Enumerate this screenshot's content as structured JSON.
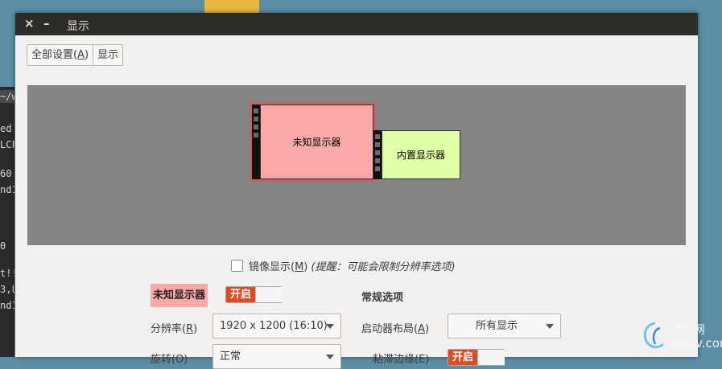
{
  "window": {
    "title": "显示",
    "close_symbol": "×",
    "minimize_symbol": "–"
  },
  "toolbar": {
    "all_settings": {
      "text": "全部设置(",
      "mnemonic": "A",
      "suffix": ")"
    },
    "display": "显示"
  },
  "monitors": [
    {
      "name": "未知显示器",
      "color": "#fba8a8",
      "selected": true
    },
    {
      "name": "内置显示器",
      "color": "#e1ffa8",
      "selected": false
    }
  ],
  "mirror": {
    "label_text": "镜像显示(",
    "label_mnemonic": "M",
    "label_suffix": ")",
    "hint": "(提醒：可能会限制分辨率选项)",
    "checked": false
  },
  "selected_monitor": {
    "name": "未知显示器",
    "toggle_label": "开启"
  },
  "general_options": {
    "title": "常规选项",
    "launcher_label": {
      "text": "启动器布局(",
      "mnemonic": "A",
      "suffix": ")"
    },
    "launcher_value": "所有显示",
    "sticky_label": "粘滞边缘(E)",
    "sticky_toggle": "开启"
  },
  "resolution": {
    "label": {
      "text": "分辨率(",
      "mnemonic": "R",
      "suffix": ")"
    },
    "value": "1920 x 1200 (16:10)"
  },
  "rotation": {
    "label": "旋转(O)",
    "value": "正常"
  },
  "terminal_fragments": [
    "~/w",
    "ed",
    "LCF",
    "60",
    "nd1",
    "0",
    "t!!",
    "3,L",
    "nd1"
  ],
  "watermark": {
    "cn": "运维网",
    "en": "iyunv.com"
  },
  "colors": {
    "titlebar": "#2d2c29",
    "canvas": "#848484",
    "toggle_on": "#df4a20",
    "desktop": "#5b8fa8"
  }
}
